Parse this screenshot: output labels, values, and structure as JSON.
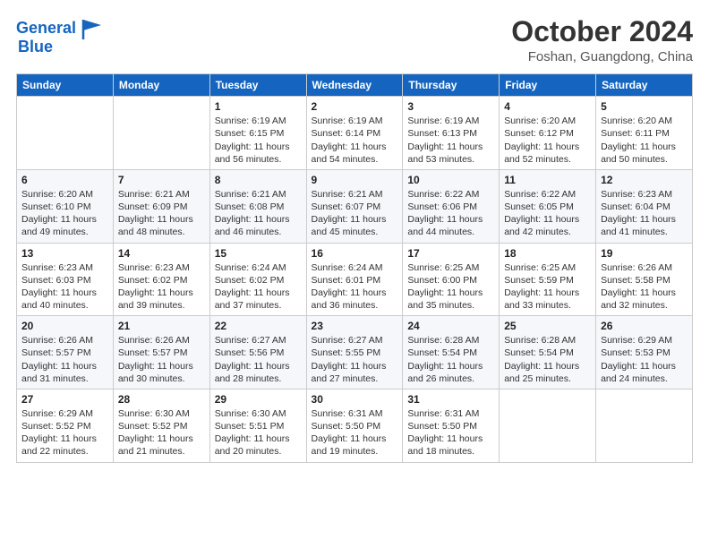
{
  "header": {
    "logo_line1": "General",
    "logo_line2": "Blue",
    "month_title": "October 2024",
    "location": "Foshan, Guangdong, China"
  },
  "weekdays": [
    "Sunday",
    "Monday",
    "Tuesday",
    "Wednesday",
    "Thursday",
    "Friday",
    "Saturday"
  ],
  "weeks": [
    [
      {
        "day": "",
        "info": ""
      },
      {
        "day": "",
        "info": ""
      },
      {
        "day": "1",
        "info": "Sunrise: 6:19 AM\nSunset: 6:15 PM\nDaylight: 11 hours and 56 minutes."
      },
      {
        "day": "2",
        "info": "Sunrise: 6:19 AM\nSunset: 6:14 PM\nDaylight: 11 hours and 54 minutes."
      },
      {
        "day": "3",
        "info": "Sunrise: 6:19 AM\nSunset: 6:13 PM\nDaylight: 11 hours and 53 minutes."
      },
      {
        "day": "4",
        "info": "Sunrise: 6:20 AM\nSunset: 6:12 PM\nDaylight: 11 hours and 52 minutes."
      },
      {
        "day": "5",
        "info": "Sunrise: 6:20 AM\nSunset: 6:11 PM\nDaylight: 11 hours and 50 minutes."
      }
    ],
    [
      {
        "day": "6",
        "info": "Sunrise: 6:20 AM\nSunset: 6:10 PM\nDaylight: 11 hours and 49 minutes."
      },
      {
        "day": "7",
        "info": "Sunrise: 6:21 AM\nSunset: 6:09 PM\nDaylight: 11 hours and 48 minutes."
      },
      {
        "day": "8",
        "info": "Sunrise: 6:21 AM\nSunset: 6:08 PM\nDaylight: 11 hours and 46 minutes."
      },
      {
        "day": "9",
        "info": "Sunrise: 6:21 AM\nSunset: 6:07 PM\nDaylight: 11 hours and 45 minutes."
      },
      {
        "day": "10",
        "info": "Sunrise: 6:22 AM\nSunset: 6:06 PM\nDaylight: 11 hours and 44 minutes."
      },
      {
        "day": "11",
        "info": "Sunrise: 6:22 AM\nSunset: 6:05 PM\nDaylight: 11 hours and 42 minutes."
      },
      {
        "day": "12",
        "info": "Sunrise: 6:23 AM\nSunset: 6:04 PM\nDaylight: 11 hours and 41 minutes."
      }
    ],
    [
      {
        "day": "13",
        "info": "Sunrise: 6:23 AM\nSunset: 6:03 PM\nDaylight: 11 hours and 40 minutes."
      },
      {
        "day": "14",
        "info": "Sunrise: 6:23 AM\nSunset: 6:02 PM\nDaylight: 11 hours and 39 minutes."
      },
      {
        "day": "15",
        "info": "Sunrise: 6:24 AM\nSunset: 6:02 PM\nDaylight: 11 hours and 37 minutes."
      },
      {
        "day": "16",
        "info": "Sunrise: 6:24 AM\nSunset: 6:01 PM\nDaylight: 11 hours and 36 minutes."
      },
      {
        "day": "17",
        "info": "Sunrise: 6:25 AM\nSunset: 6:00 PM\nDaylight: 11 hours and 35 minutes."
      },
      {
        "day": "18",
        "info": "Sunrise: 6:25 AM\nSunset: 5:59 PM\nDaylight: 11 hours and 33 minutes."
      },
      {
        "day": "19",
        "info": "Sunrise: 6:26 AM\nSunset: 5:58 PM\nDaylight: 11 hours and 32 minutes."
      }
    ],
    [
      {
        "day": "20",
        "info": "Sunrise: 6:26 AM\nSunset: 5:57 PM\nDaylight: 11 hours and 31 minutes."
      },
      {
        "day": "21",
        "info": "Sunrise: 6:26 AM\nSunset: 5:57 PM\nDaylight: 11 hours and 30 minutes."
      },
      {
        "day": "22",
        "info": "Sunrise: 6:27 AM\nSunset: 5:56 PM\nDaylight: 11 hours and 28 minutes."
      },
      {
        "day": "23",
        "info": "Sunrise: 6:27 AM\nSunset: 5:55 PM\nDaylight: 11 hours and 27 minutes."
      },
      {
        "day": "24",
        "info": "Sunrise: 6:28 AM\nSunset: 5:54 PM\nDaylight: 11 hours and 26 minutes."
      },
      {
        "day": "25",
        "info": "Sunrise: 6:28 AM\nSunset: 5:54 PM\nDaylight: 11 hours and 25 minutes."
      },
      {
        "day": "26",
        "info": "Sunrise: 6:29 AM\nSunset: 5:53 PM\nDaylight: 11 hours and 24 minutes."
      }
    ],
    [
      {
        "day": "27",
        "info": "Sunrise: 6:29 AM\nSunset: 5:52 PM\nDaylight: 11 hours and 22 minutes."
      },
      {
        "day": "28",
        "info": "Sunrise: 6:30 AM\nSunset: 5:52 PM\nDaylight: 11 hours and 21 minutes."
      },
      {
        "day": "29",
        "info": "Sunrise: 6:30 AM\nSunset: 5:51 PM\nDaylight: 11 hours and 20 minutes."
      },
      {
        "day": "30",
        "info": "Sunrise: 6:31 AM\nSunset: 5:50 PM\nDaylight: 11 hours and 19 minutes."
      },
      {
        "day": "31",
        "info": "Sunrise: 6:31 AM\nSunset: 5:50 PM\nDaylight: 11 hours and 18 minutes."
      },
      {
        "day": "",
        "info": ""
      },
      {
        "day": "",
        "info": ""
      }
    ]
  ]
}
